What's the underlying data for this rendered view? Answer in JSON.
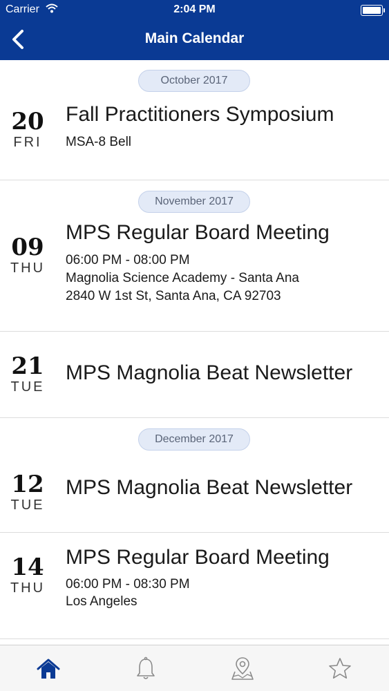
{
  "status_bar": {
    "carrier": "Carrier",
    "time": "2:04 PM"
  },
  "nav": {
    "title": "Main Calendar"
  },
  "months": [
    "October 2017",
    "November 2017",
    "December 2017"
  ],
  "events": [
    {
      "day": "20",
      "weekday": "FRI",
      "title": "Fall Practitioners Symposium",
      "location": "MSA-8 Bell"
    },
    {
      "day": "09",
      "weekday": "THU",
      "title": "MPS Regular Board Meeting",
      "time": "06:00 PM - 08:00 PM",
      "location": "Magnolia Science Academy - Santa Ana",
      "address": "2840 W 1st St, Santa Ana, CA 92703"
    },
    {
      "day": "21",
      "weekday": "TUE",
      "title": "MPS Magnolia Beat Newsletter"
    },
    {
      "day": "12",
      "weekday": "TUE",
      "title": "MPS Magnolia Beat Newsletter"
    },
    {
      "day": "14",
      "weekday": "THU",
      "title": "MPS Regular Board Meeting",
      "time": "06:00 PM - 08:30 PM",
      "location": "Los Angeles"
    }
  ],
  "tabs": [
    {
      "icon": "home-icon",
      "active": true
    },
    {
      "icon": "bell-icon",
      "active": false
    },
    {
      "icon": "map-pin-icon",
      "active": false
    },
    {
      "icon": "star-icon",
      "active": false
    }
  ],
  "colors": {
    "header": "#0a3a94",
    "pill_bg": "#e3eaf7",
    "active_tab": "#0a3a94",
    "inactive_tab": "#8a8a8a"
  }
}
